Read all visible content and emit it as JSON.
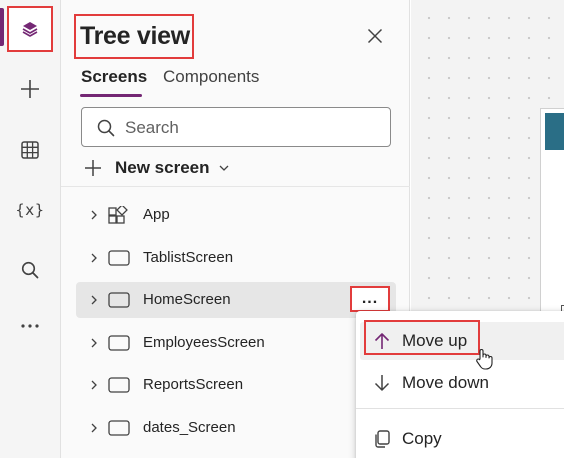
{
  "rail": {
    "items": [
      {
        "icon": "layers-icon",
        "active": true
      },
      {
        "icon": "plus-icon"
      },
      {
        "icon": "table-icon"
      },
      {
        "icon": "variable-icon",
        "glyph": "{x}"
      },
      {
        "icon": "search-icon"
      },
      {
        "icon": "more-icon"
      }
    ]
  },
  "panel": {
    "title": "Tree view",
    "tabs": [
      {
        "label": "Screens",
        "active": true
      },
      {
        "label": "Components",
        "active": false
      }
    ],
    "search_placeholder": "Search",
    "new_screen_label": "New screen",
    "screens": [
      {
        "name": "App",
        "icon": "app-icon"
      },
      {
        "name": "TablistScreen",
        "icon": "screen-icon"
      },
      {
        "name": "HomeScreen",
        "icon": "screen-icon",
        "selected": true,
        "more": "..."
      },
      {
        "name": "EmployeesScreen",
        "icon": "screen-icon"
      },
      {
        "name": "ReportsScreen",
        "icon": "screen-icon"
      },
      {
        "name": "dates_Screen",
        "icon": "screen-icon"
      }
    ]
  },
  "context_menu": {
    "items": [
      {
        "label": "Move up",
        "icon": "arrow-up-icon",
        "hovered": true
      },
      {
        "label": "Move down",
        "icon": "arrow-down-icon"
      },
      {
        "label": "Copy",
        "icon": "copy-icon"
      }
    ]
  },
  "colors": {
    "accent": "#742774",
    "highlight_box": "#e23c3c",
    "canvas_header": "#2a6e86"
  }
}
